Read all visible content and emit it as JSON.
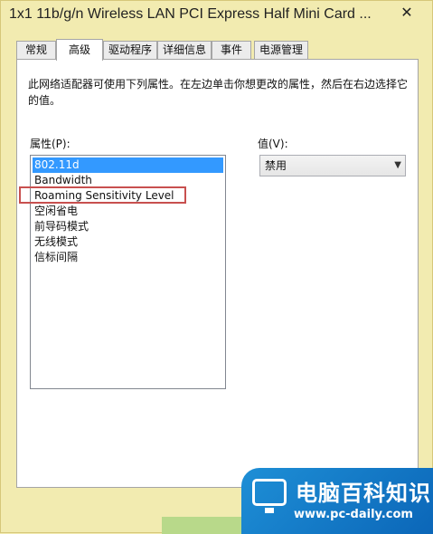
{
  "window": {
    "title": "1x1 11b/g/n Wireless LAN PCI Express Half Mini Card ...",
    "close_glyph": "✕"
  },
  "tabs": [
    {
      "label": "常规",
      "active": false
    },
    {
      "label": "高级",
      "active": true
    },
    {
      "label": "驱动程序",
      "active": false
    },
    {
      "label": "详细信息",
      "active": false
    },
    {
      "label": "事件",
      "active": false
    },
    {
      "label": "电源管理",
      "active": false
    }
  ],
  "panel": {
    "description": "此网络适配器可使用下列属性。在左边单击你想更改的属性，然后在右边选择它的值。",
    "property_label": "属性(P):",
    "value_label": "值(V):",
    "properties": [
      {
        "label": "802.11d",
        "selected": true
      },
      {
        "label": "Bandwidth",
        "selected": false
      },
      {
        "label": "Roaming Sensitivity Level",
        "selected": false
      },
      {
        "label": "空闲省电",
        "selected": false
      },
      {
        "label": "前导码模式",
        "selected": false
      },
      {
        "label": "无线模式",
        "selected": false
      },
      {
        "label": "信标间隔",
        "selected": false
      }
    ],
    "value_selected": "禁用",
    "highlighted_property": "Roaming Sensitivity Level"
  },
  "watermark": {
    "brand": "电脑百科知识",
    "url": "www.pc-daily.com"
  },
  "colors": {
    "selection": "#3399ff",
    "highlight_border": "#c8504f",
    "window_frame": "#f2ebb0"
  }
}
